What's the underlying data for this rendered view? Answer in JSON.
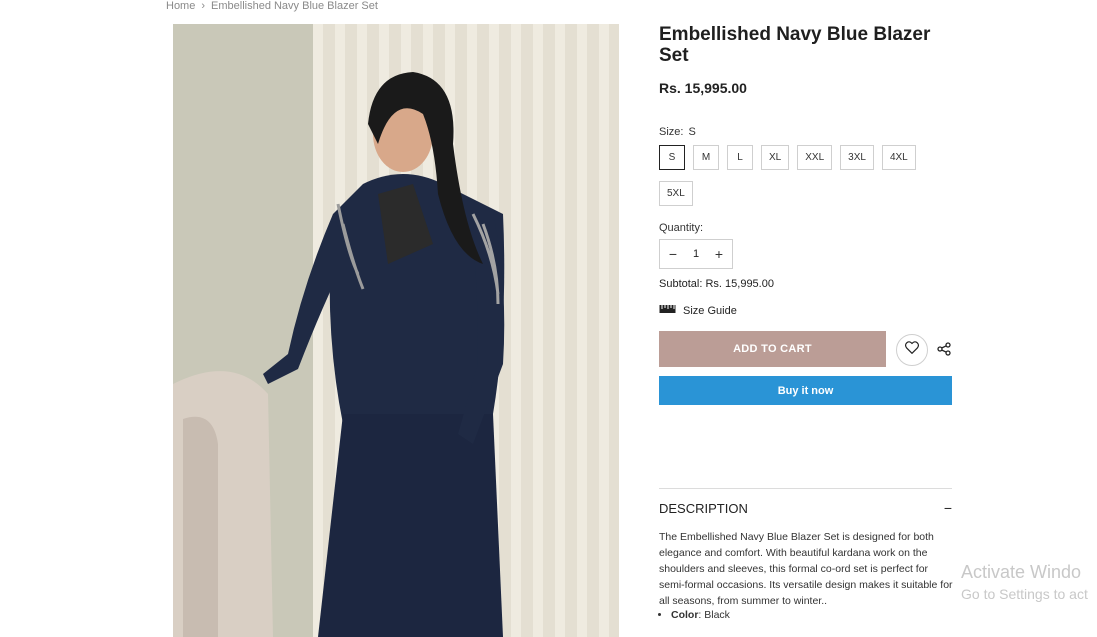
{
  "breadcrumb": {
    "home": "Home",
    "separator": "›",
    "current": "Embellished Navy Blue Blazer Set"
  },
  "product": {
    "title": "Embellished Navy Blue Blazer Set",
    "price": "Rs. 15,995.00",
    "size_label": "Size:",
    "selected_size": "S",
    "sizes_row1": [
      "S",
      "M",
      "L",
      "XL",
      "XXL",
      "3XL",
      "4XL"
    ],
    "sizes_row2": [
      "5XL"
    ],
    "quantity_label": "Quantity:",
    "quantity_value": "1",
    "quantity_minus": "−",
    "quantity_plus": "+",
    "subtotal": "Subtotal: Rs. 15,995.00",
    "size_guide": "Size Guide",
    "add_to_cart": "ADD TO CART",
    "buy_now": "Buy it now"
  },
  "description": {
    "title": "DESCRIPTION",
    "toggle": "−",
    "text": "The Embellished Navy Blue Blazer Set is designed for both elegance and comfort. With beautiful kardana work on the shoulders and sleeves, this formal co-ord set is perfect for semi-formal occasions. Its versatile design makes it suitable for all seasons, from summer to winter..",
    "color_key": "Color",
    "color_value": ": Black"
  },
  "watermark": {
    "line1": "Activate Windo",
    "line2": "Go to Settings to act"
  },
  "colors": {
    "add_to_cart": "#bb9d96",
    "buy_now": "#2a94d6",
    "navy": "#1f2a44"
  },
  "icons": {
    "wishlist": "heart-icon",
    "share": "share-icon",
    "size_guide": "ruler-icon"
  }
}
